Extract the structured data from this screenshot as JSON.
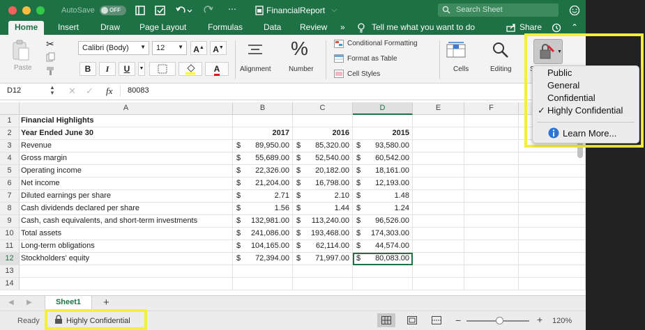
{
  "titlebar": {
    "autosave_label": "AutoSave",
    "autosave_state": "OFF",
    "file_name": "FinancialReport",
    "search_placeholder": "Search Sheet"
  },
  "tabs": [
    "Home",
    "Insert",
    "Draw",
    "Page Layout",
    "Formulas",
    "Data",
    "Review"
  ],
  "tell_me": "Tell me what you want to do",
  "share_label": "Share",
  "ribbon": {
    "paste_label": "Paste",
    "font_name": "Calibri (Body)",
    "font_size": "12",
    "bold": "B",
    "italic": "I",
    "underline": "U",
    "alignment_label": "Alignment",
    "number_label": "Number",
    "conditional_formatting": "Conditional Formatting",
    "format_as_table": "Format as Table",
    "cell_styles": "Cell Styles",
    "cells_label": "Cells",
    "editing_label": "Editing",
    "sensitivity_partial": "S"
  },
  "formula_bar": {
    "name_box": "D12",
    "fx": "fx",
    "value": "80083"
  },
  "columns": [
    "A",
    "B",
    "C",
    "D",
    "E",
    "F"
  ],
  "rows": [
    {
      "n": "1",
      "a": "Financial Highlights",
      "bold": true,
      "b": "",
      "c": "",
      "d": ""
    },
    {
      "n": "2",
      "a": "Year Ended June 30",
      "bold": true,
      "b": "2017",
      "c": "2016",
      "d": "2015"
    },
    {
      "n": "3",
      "a": "Revenue",
      "b": "89,950.00",
      "c": "85,320.00",
      "d": "93,580.00"
    },
    {
      "n": "4",
      "a": "Gross margin",
      "b": "55,689.00",
      "c": "52,540.00",
      "d": "60,542.00"
    },
    {
      "n": "5",
      "a": "Operating income",
      "b": "22,326.00",
      "c": "20,182.00",
      "d": "18,161.00"
    },
    {
      "n": "6",
      "a": "Net income",
      "b": "21,204.00",
      "c": "16,798.00",
      "d": "12,193.00"
    },
    {
      "n": "7",
      "a": "Diluted earnings per share",
      "b": "2.71",
      "c": "2.10",
      "d": "1.48"
    },
    {
      "n": "8",
      "a": "Cash dividends declared per share",
      "b": "1.56",
      "c": "1.44",
      "d": "1.24"
    },
    {
      "n": "9",
      "a": "Cash, cash equivalents, and short-term investments",
      "b": "132,981.00",
      "c": "113,240.00",
      "d": "96,526.00"
    },
    {
      "n": "10",
      "a": "Total assets",
      "b": "241,086.00",
      "c": "193,468.00",
      "d": "174,303.00"
    },
    {
      "n": "11",
      "a": "Long-term obligations",
      "b": "104,165.00",
      "c": "62,114.00",
      "d": "44,574.00"
    },
    {
      "n": "12",
      "a": "Stockholders' equity",
      "b": "72,394.00",
      "c": "71,997.00",
      "d": "80,083.00"
    },
    {
      "n": "13",
      "a": "",
      "b": "",
      "c": "",
      "d": ""
    },
    {
      "n": "14",
      "a": "",
      "b": "",
      "c": "",
      "d": ""
    }
  ],
  "currency_symbol": "$",
  "sheet_tab": "Sheet1",
  "status": {
    "ready": "Ready",
    "sensitivity": "Highly Confidential",
    "zoom": "120%"
  },
  "sensitivity_menu": {
    "items": [
      "Public",
      "General",
      "Confidential",
      "Highly Confidential"
    ],
    "checked": "Highly Confidential",
    "learn_more": "Learn More..."
  },
  "colors": {
    "excel_green": "#1e7145",
    "highlight_yellow": "#f3f03a"
  }
}
